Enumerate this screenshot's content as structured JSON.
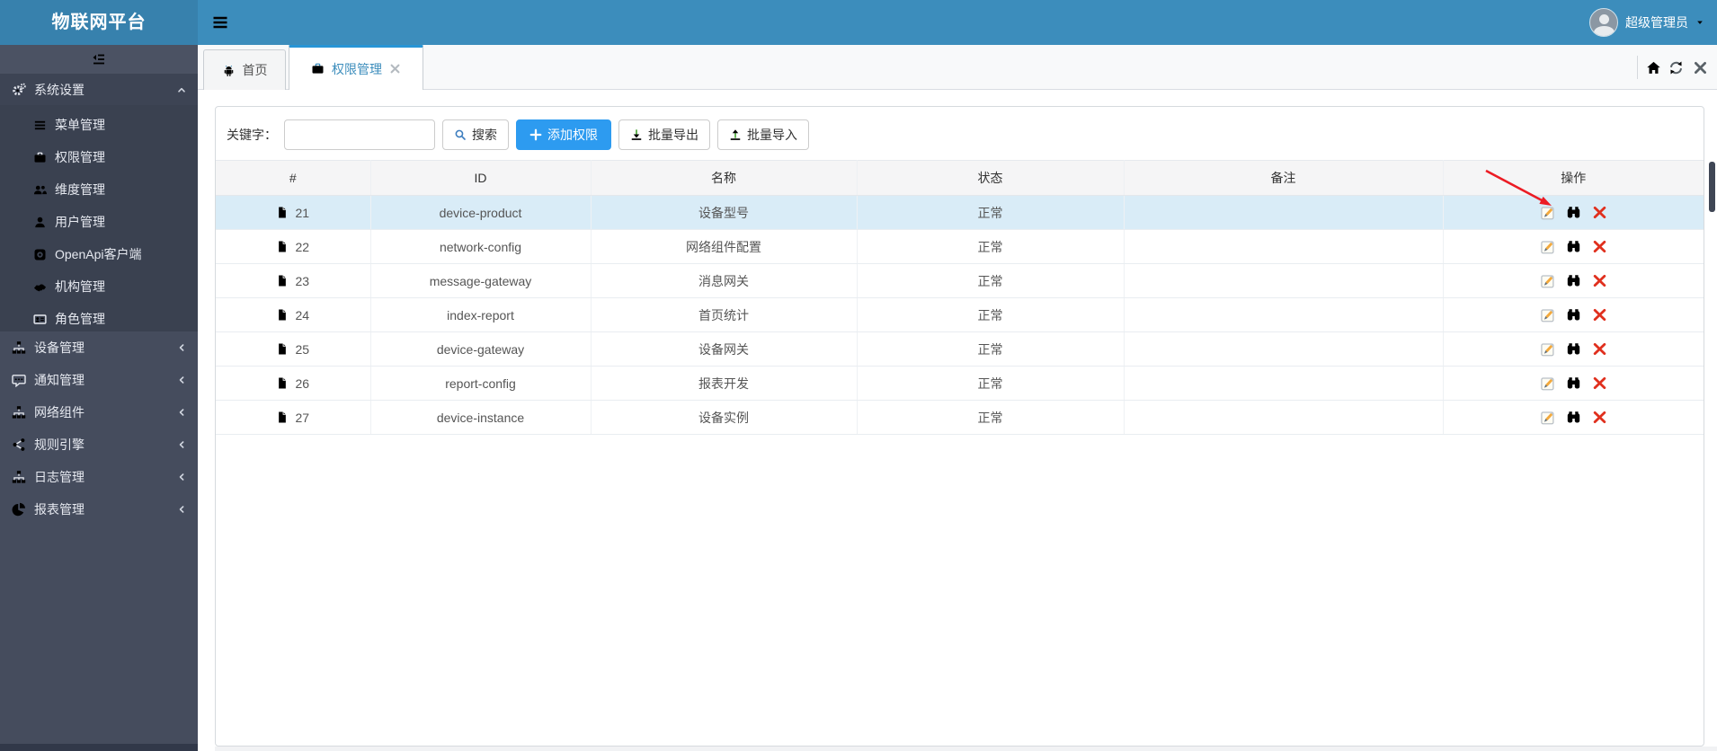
{
  "app": {
    "logo_title": "物联网平台"
  },
  "header": {
    "username": "超级管理员",
    "icons": {
      "menu": "hamburger-icon",
      "user_caret": "caret-down-icon",
      "avatar": "avatar"
    }
  },
  "sidebar": {
    "toggle_icon": "indent-icon",
    "system": {
      "label": "系统设置",
      "icon": "cogs-icon",
      "state_icon": "angle-up-icon"
    },
    "system_children": [
      {
        "label": "菜单管理",
        "icon": "list-icon"
      },
      {
        "label": "权限管理",
        "icon": "briefcase-icon"
      },
      {
        "label": "维度管理",
        "icon": "users-icon"
      },
      {
        "label": "用户管理",
        "icon": "user-icon"
      },
      {
        "label": "OpenApi客户端",
        "icon": "openapi-client-icon"
      },
      {
        "label": "机构管理",
        "icon": "handshake-icon"
      },
      {
        "label": "角色管理",
        "icon": "id-card-icon"
      }
    ],
    "parents": [
      {
        "label": "设备管理",
        "icon": "sitemap-icon",
        "state_icon": "angle-left-icon"
      },
      {
        "label": "通知管理",
        "icon": "comment-icon",
        "state_icon": "angle-left-icon"
      },
      {
        "label": "网络组件",
        "icon": "sitemap-icon",
        "state_icon": "angle-left-icon"
      },
      {
        "label": "规则引擎",
        "icon": "share-icon",
        "state_icon": "angle-left-icon"
      },
      {
        "label": "日志管理",
        "icon": "sitemap-icon",
        "state_icon": "angle-left-icon"
      },
      {
        "label": "报表管理",
        "icon": "pie-chart-icon",
        "state_icon": "angle-left-icon"
      }
    ]
  },
  "tabs": {
    "home": {
      "label": "首页",
      "icon": "android-icon"
    },
    "active": {
      "label": "权限管理",
      "icon": "briefcase-icon",
      "close_icon": "close-icon"
    },
    "controls": [
      "home-icon",
      "refresh-icon",
      "close-icon"
    ]
  },
  "toolbar": {
    "keyword_label": "关键字：",
    "keyword_value": "",
    "search_label": "搜索",
    "add_label": "添加权限",
    "export_label": "批量导出",
    "import_label": "批量导入"
  },
  "table": {
    "headers": [
      "#",
      "ID",
      "名称",
      "状态",
      "备注",
      "操作"
    ],
    "row_icons": {
      "num": "file-icon",
      "actions": [
        "edit-icon",
        "binoculars-icon",
        "delete-icon"
      ]
    },
    "rows": [
      {
        "num": "21",
        "id": "device-product",
        "name": "设备型号",
        "status": "正常",
        "remark": ""
      },
      {
        "num": "22",
        "id": "network-config",
        "name": "网络组件配置",
        "status": "正常",
        "remark": ""
      },
      {
        "num": "23",
        "id": "message-gateway",
        "name": "消息网关",
        "status": "正常",
        "remark": ""
      },
      {
        "num": "24",
        "id": "index-report",
        "name": "首页统计",
        "status": "正常",
        "remark": ""
      },
      {
        "num": "25",
        "id": "device-gateway",
        "name": "设备网关",
        "status": "正常",
        "remark": ""
      },
      {
        "num": "26",
        "id": "report-config",
        "name": "报表开发",
        "status": "正常",
        "remark": ""
      },
      {
        "num": "27",
        "id": "device-instance",
        "name": "设备实例",
        "status": "正常",
        "remark": ""
      }
    ]
  },
  "annotation": {
    "shape": "red-arrow",
    "points_at": "row-21-edit-icon"
  },
  "colors": {
    "navbar": "#3c8dbc",
    "logo_bg": "#3781ad",
    "sidebar": "#454c5d",
    "submenu": "#3a4150",
    "active_tab_border": "#2795d6",
    "add_button": "#2d9bf0",
    "selected_row": "#d9ecf7",
    "export_green": "#62b452",
    "delete_red": "#e0301e",
    "annotation_red": "#ec1c24"
  }
}
